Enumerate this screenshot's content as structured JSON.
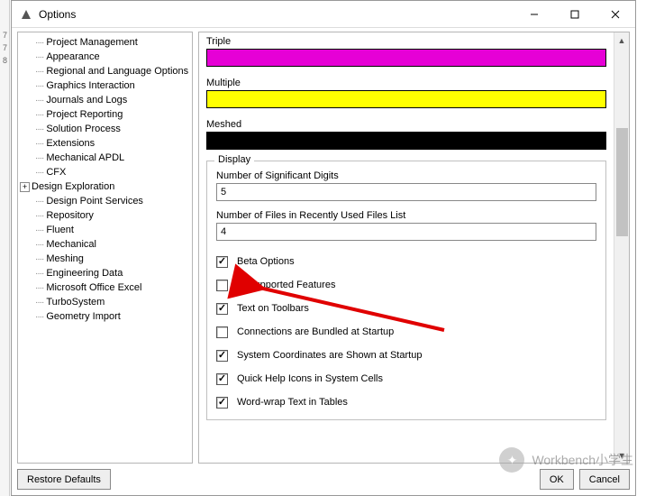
{
  "window": {
    "title": "Options"
  },
  "tree": {
    "items": [
      {
        "label": "Project Management",
        "level": 1
      },
      {
        "label": "Appearance",
        "level": 1
      },
      {
        "label": "Regional and Language Options",
        "level": 1
      },
      {
        "label": "Graphics Interaction",
        "level": 1
      },
      {
        "label": "Journals and Logs",
        "level": 1
      },
      {
        "label": "Project Reporting",
        "level": 1
      },
      {
        "label": "Solution Process",
        "level": 1
      },
      {
        "label": "Extensions",
        "level": 1
      },
      {
        "label": "Mechanical APDL",
        "level": 1
      },
      {
        "label": "CFX",
        "level": 1
      },
      {
        "label": "Design Exploration",
        "level": 0,
        "expandable": true
      },
      {
        "label": "Design Point Services",
        "level": 1
      },
      {
        "label": "Repository",
        "level": 1
      },
      {
        "label": "Fluent",
        "level": 1
      },
      {
        "label": "Mechanical",
        "level": 1
      },
      {
        "label": "Meshing",
        "level": 1
      },
      {
        "label": "Engineering Data",
        "level": 1
      },
      {
        "label": "Microsoft Office Excel",
        "level": 1
      },
      {
        "label": "TurboSystem",
        "level": 1
      },
      {
        "label": "Geometry Import",
        "level": 1
      }
    ]
  },
  "colors": {
    "triple": {
      "label": "Triple",
      "hex": "#E600D6"
    },
    "multiple": {
      "label": "Multiple",
      "hex": "#FFFF00"
    },
    "meshed": {
      "label": "Meshed",
      "hex": "#000000"
    }
  },
  "display": {
    "legend": "Display",
    "sig_digits_label": "Number of Significant Digits",
    "sig_digits_value": "5",
    "recent_files_label": "Number of Files in Recently Used Files List",
    "recent_files_value": "4",
    "checks": [
      {
        "label": "Beta Options",
        "checked": true
      },
      {
        "label": "Unsupported Features",
        "checked": false
      },
      {
        "label": "Text on Toolbars",
        "checked": true
      },
      {
        "label": "Connections are Bundled at Startup",
        "checked": false
      },
      {
        "label": "System Coordinates are Shown at Startup",
        "checked": true
      },
      {
        "label": "Quick Help Icons in System Cells",
        "checked": true
      },
      {
        "label": "Word-wrap Text in Tables",
        "checked": true
      }
    ]
  },
  "footer": {
    "restore": "Restore Defaults",
    "ok": "OK",
    "cancel": "Cancel"
  },
  "watermark": "Workbench小学生"
}
